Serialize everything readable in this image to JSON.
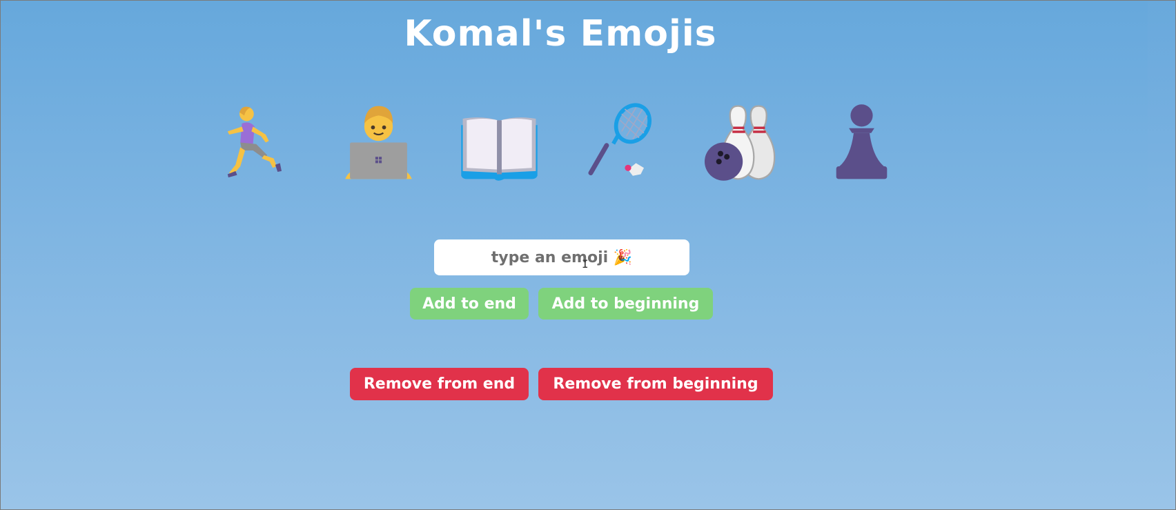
{
  "page": {
    "title": "Komal's Emojis"
  },
  "emojis": [
    {
      "name": "woman-running-icon",
      "accent": "#8a6ad0"
    },
    {
      "name": "man-technologist-icon",
      "accent": "#f8b500"
    },
    {
      "name": "open-book-icon",
      "accent": "#1a9fe6"
    },
    {
      "name": "badminton-icon",
      "accent": "#1a9fe6"
    },
    {
      "name": "bowling-icon",
      "accent": "#5b4f8a"
    },
    {
      "name": "chess-pawn-icon",
      "accent": "#5b4f8a"
    }
  ],
  "input": {
    "placeholder": "type an emoji 🎉"
  },
  "buttons": {
    "add_end": "Add to end",
    "add_beginning": "Add to beginning",
    "remove_end": "Remove from end",
    "remove_beginning": "Remove from beginning"
  },
  "colors": {
    "add_button": "#7fd27d",
    "remove_button": "#e1324a",
    "title": "#ffffff"
  }
}
